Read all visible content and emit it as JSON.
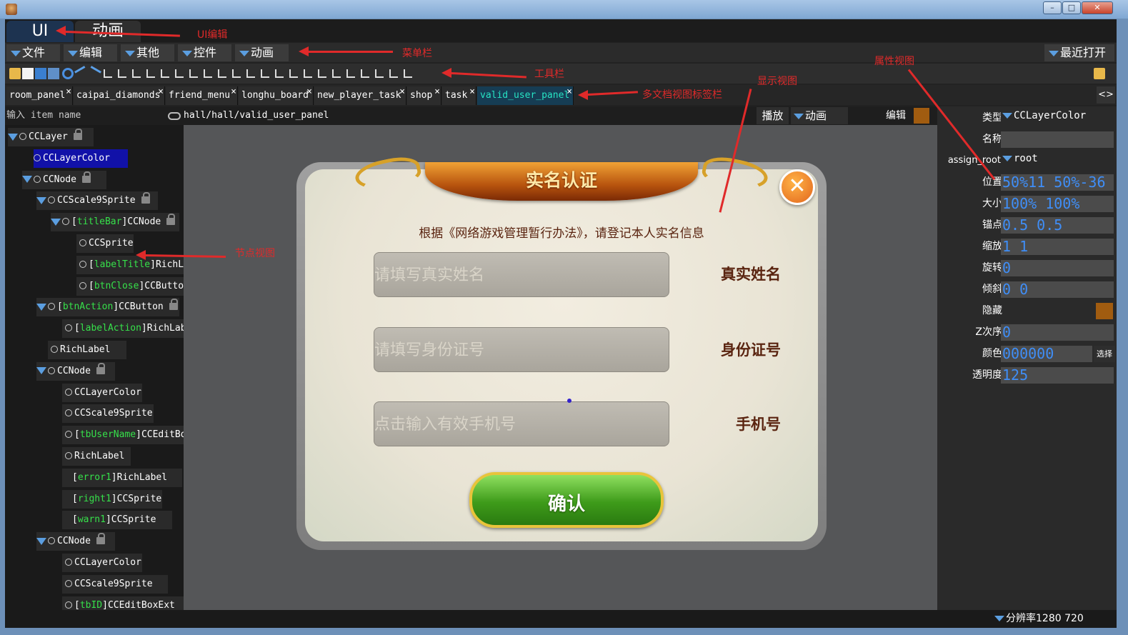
{
  "mode_tabs": [
    {
      "label": "UI"
    },
    {
      "label": "动画"
    }
  ],
  "menu": [
    "文件",
    "编辑",
    "其他",
    "控件",
    "动画"
  ],
  "menu_right": "最近打开",
  "doc_tabs": [
    "room_panel",
    "caipai_diamonds",
    "friend_menu",
    "longhu_board",
    "new_player_task",
    "shop",
    "task",
    "valid_user_panel"
  ],
  "tab_nav": "<>",
  "tree": {
    "search_placeholder": "输入 item name",
    "nodes": [
      {
        "label": "CCLayer",
        "tag": ""
      },
      {
        "label": "CCLayerColor",
        "tag": ""
      },
      {
        "label": "CCNode",
        "tag": ""
      },
      {
        "label": "CCScale9Sprite",
        "tag": ""
      },
      {
        "label": "CCNode",
        "tag": "titleBar"
      },
      {
        "label": "CCSprite",
        "tag": ""
      },
      {
        "label": "RichLabel",
        "tag": "labelTitle"
      },
      {
        "label": "CCButton",
        "tag": "btnClose"
      },
      {
        "label": "CCButton",
        "tag": "btnAction"
      },
      {
        "label": "RichLabel",
        "tag": "labelAction"
      },
      {
        "label": "RichLabel",
        "tag": ""
      },
      {
        "label": "CCNode",
        "tag": ""
      },
      {
        "label": "CCLayerColor",
        "tag": ""
      },
      {
        "label": "CCScale9Sprite",
        "tag": ""
      },
      {
        "label": "CCEditBox",
        "tag": "tbUserName"
      },
      {
        "label": "RichLabel",
        "tag": ""
      },
      {
        "label": "RichLabel",
        "tag": "error1"
      },
      {
        "label": "CCSprite",
        "tag": "right1"
      },
      {
        "label": "CCSprite",
        "tag": "warn1"
      },
      {
        "label": "CCNode",
        "tag": ""
      },
      {
        "label": "CCLayerColor",
        "tag": ""
      },
      {
        "label": "CCScale9Sprite",
        "tag": ""
      },
      {
        "label": "CCEditBoxExt",
        "tag": "tbID"
      }
    ]
  },
  "view": {
    "path": "hall/hall/valid_user_panel",
    "play_label": "播放",
    "anim_label": "动画",
    "edit_label": "编辑"
  },
  "dialog": {
    "title": "实名认证",
    "notice": "根据《网络游戏管理暂行办法》，请登记本人实名信息",
    "fields": [
      {
        "placeholder": "请填写真实姓名",
        "label": "真实姓名"
      },
      {
        "placeholder": "请填写身份证号",
        "label": "身份证号"
      },
      {
        "placeholder": "点击输入有效手机号",
        "label": "手机号"
      }
    ],
    "confirm_label": "确认",
    "close_glyph": "✕"
  },
  "props": {
    "type_label": "类型",
    "type_value": "CCLayerColor",
    "name_label": "名称",
    "name_value": "",
    "assign_label": "assign_root",
    "assign_value": "root",
    "pos_label": "位置",
    "pos_value": "50%11 50%-36",
    "size_label": "大小",
    "size_value": "100% 100%",
    "anchor_label": "锚点",
    "anchor_value": "0.5 0.5",
    "scale_label": "缩放",
    "scale_value": "1 1",
    "rot_label": "旋转",
    "rot_value": "0",
    "skew_label": "倾斜",
    "skew_value": "0 0",
    "hide_label": "隐藏",
    "z_label": "Z次序",
    "z_value": "0",
    "color_label": "颜色",
    "color_value": "000000",
    "color_btn": "选择",
    "alpha_label": "透明度",
    "alpha_value": "125"
  },
  "status": {
    "resolution": "分辨率1280 720"
  },
  "annotations": {
    "ui_edit": "UI编辑",
    "menubar": "菜单栏",
    "toolbar": "工具栏",
    "props_view": "属性视图",
    "display_view": "显示视图",
    "tabbar": "多文档视图标签栏",
    "node_view": "节点视图"
  },
  "window_buttons": {
    "min": "–",
    "max": "□",
    "close": "✕"
  }
}
